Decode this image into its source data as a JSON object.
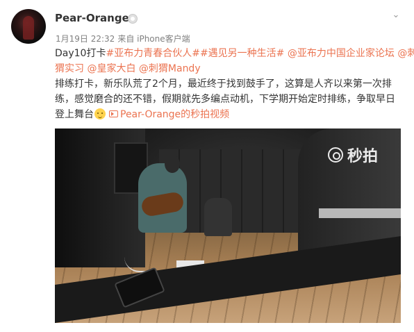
{
  "user": {
    "name": "Pear-Orange",
    "time": "1月19日 22:32",
    "source": "来自 iPhone客户端"
  },
  "post": {
    "line1_prefix": "Day10打卡",
    "line1_tag1": "#亚布力青春合伙人#",
    "line1_tag2": "#遇见另一种生活#",
    "line1_mention1": "@亚布力中国企业家论坛",
    "line1_mention2_a": "@刺",
    "line2_mention2_b": "猬实习",
    "line2_mention3": "@皇家大白",
    "line2_mention4": "@刺猬Mandy",
    "line3": "排练打卡，新乐队荒了2个月，最近终于找到鼓手了，这算是人齐以来第一次排",
    "line4": "练，感觉磨合的还不错，假期就先多编点动机，下学期开始定时排练，争取早日",
    "line5_prefix": "登上舞台",
    "video_link": "Pear-Orange的秒拍视频"
  },
  "video": {
    "watermark": "秒拍"
  },
  "icons": {
    "badge": "member-badge-icon",
    "menu": "chevron-down-icon",
    "emoji": "smile-emoji-icon",
    "video": "video-link-icon",
    "watermark": "miaopai-logo-icon"
  },
  "colors": {
    "link": "#eb7350",
    "text": "#333333",
    "meta": "#808080"
  }
}
